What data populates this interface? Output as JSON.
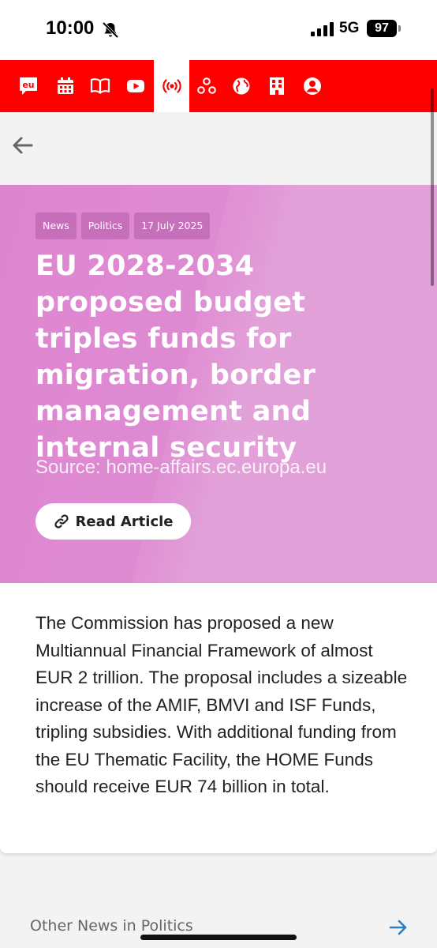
{
  "status_bar": {
    "time": "10:00",
    "network": "5G",
    "battery": "97"
  },
  "navbar": {
    "background": "#ff0000",
    "items": [
      {
        "icon": "eu-logo-icon",
        "label": "eu"
      },
      {
        "icon": "calendar-icon"
      },
      {
        "icon": "book-icon"
      },
      {
        "icon": "youtube-icon"
      },
      {
        "icon": "broadcast-icon",
        "active": true
      },
      {
        "icon": "network-icon"
      },
      {
        "icon": "globe-icon"
      },
      {
        "icon": "building-icon"
      },
      {
        "icon": "user-icon"
      }
    ]
  },
  "article": {
    "tags": [
      "News",
      "Politics",
      "17 July 2025"
    ],
    "title": "EU 2028-2034 proposed budget triples funds for migration, border management and internal security",
    "source": "Source: home-affairs.ec.europa.eu",
    "read_button": "Read Article",
    "summary": "The Commission has proposed a new Multiannual Financial Framework of almost EUR 2 trillion. The proposal includes a sizeable increase of the AMIF, BMVI and ISF Funds, tripling subsidies. With additional funding from the EU Thematic Facility, the HOME Funds should receive EUR 74 billion in total."
  },
  "other_news": {
    "label": "Other News in Politics"
  },
  "colors": {
    "accent": "#ff0000",
    "hero": "#de8bd2",
    "link_arrow": "#2f7fc1"
  }
}
